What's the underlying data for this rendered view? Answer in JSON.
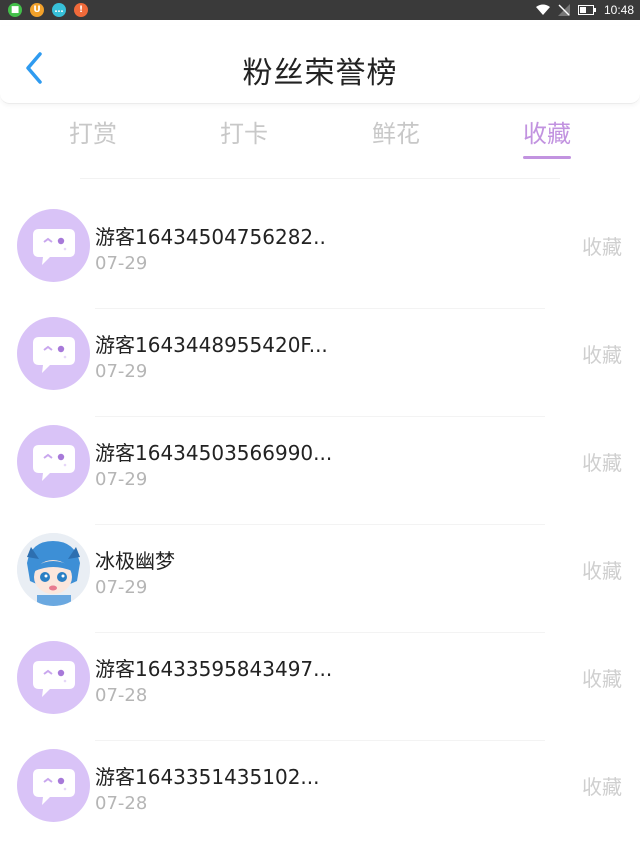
{
  "status_bar": {
    "time": "10:48",
    "apps": [
      {
        "icon": "chat-app-icon",
        "color": "#43c04a",
        "glyph": "■"
      },
      {
        "icon": "uc-app-icon",
        "color": "#f2a12a",
        "glyph": "U"
      },
      {
        "icon": "message-app-icon",
        "color": "#37c0d8",
        "glyph": "…"
      },
      {
        "icon": "alert-app-icon",
        "color": "#f06a3a",
        "glyph": "!"
      }
    ]
  },
  "header": {
    "title": "粉丝荣誉榜"
  },
  "tabs": [
    {
      "label": "打赏",
      "active": false
    },
    {
      "label": "打卡",
      "active": false
    },
    {
      "label": "鲜花",
      "active": false
    },
    {
      "label": "收藏",
      "active": true
    }
  ],
  "colors": {
    "accent": "#c293e0",
    "avatar_bg": "#d9c3f7"
  },
  "list": [
    {
      "name": "游客16434504756282..",
      "date": "07-29",
      "action": "收藏",
      "avatar": "default-chat-avatar"
    },
    {
      "name": "游客1643448955420F...",
      "date": "07-29",
      "action": "收藏",
      "avatar": "default-chat-avatar"
    },
    {
      "name": "游客16434503566990...",
      "date": "07-29",
      "action": "收藏",
      "avatar": "default-chat-avatar"
    },
    {
      "name": "冰极幽梦",
      "date": "07-29",
      "action": "收藏",
      "avatar": "anime-character-avatar"
    },
    {
      "name": "游客16433595843497...",
      "date": "07-28",
      "action": "收藏",
      "avatar": "default-chat-avatar"
    },
    {
      "name": "游客1643351435102...",
      "date": "07-28",
      "action": "收藏",
      "avatar": "default-chat-avatar"
    }
  ]
}
